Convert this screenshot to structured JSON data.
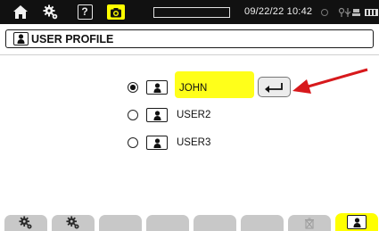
{
  "status_bar": {
    "datetime": "09/22/22 10:42",
    "usb_glyph": "⇩⚲",
    "progress_fraction": 0,
    "icons": [
      "home-icon",
      "gear-icon",
      "help-icon",
      "camera-icon",
      "record-indicator-icon",
      "usb-icon",
      "battery-icon"
    ],
    "help_label": "?"
  },
  "title_bar": {
    "title": "USER PROFILE",
    "icon": "user-icon"
  },
  "profiles": [
    {
      "name": "JOHN",
      "selected": true
    },
    {
      "name": "USER2",
      "selected": false
    },
    {
      "name": "USER3",
      "selected": false
    }
  ],
  "enter_button": {
    "icon": "enter-arrow-icon"
  },
  "annotation": {
    "color": "#d7191c",
    "icon": "arrow-pointer-icon"
  },
  "tabs": [
    {
      "icon": "gear-settings-icon",
      "active": false
    },
    {
      "icon": "gear-settings-icon",
      "active": false
    },
    {
      "icon": "",
      "active": false
    },
    {
      "icon": "",
      "active": false
    },
    {
      "icon": "",
      "active": false
    },
    {
      "icon": "",
      "active": false
    },
    {
      "icon": "trash-icon",
      "active": false
    },
    {
      "icon": "user-icon",
      "active": true
    }
  ],
  "colors": {
    "status_bar_bg": "#111111",
    "highlight": "#ffff00",
    "tab_inactive": "#c8c8c8",
    "arrow": "#d7191c"
  }
}
